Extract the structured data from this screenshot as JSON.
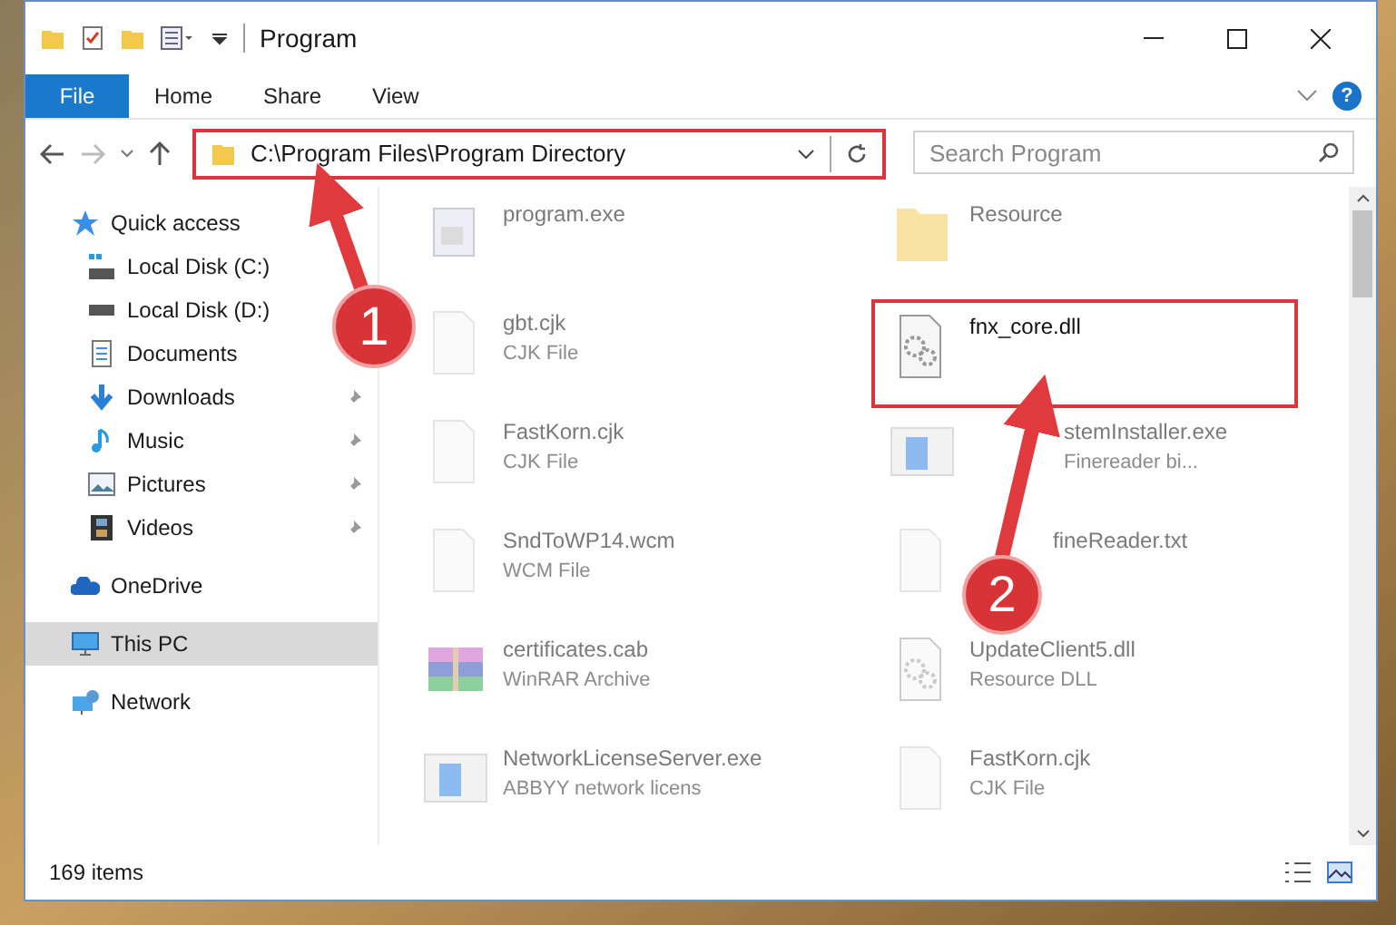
{
  "window": {
    "title": "Program"
  },
  "ribbon": {
    "tabs": [
      {
        "label": "File",
        "kind": "menu"
      },
      {
        "label": "Home",
        "kind": "tab"
      },
      {
        "label": "Share",
        "kind": "tab"
      },
      {
        "label": "View",
        "kind": "tab"
      }
    ],
    "help_button": "?"
  },
  "address_bar": {
    "path": "C:\\Program Files\\Program Directory",
    "highlighted": true
  },
  "search": {
    "placeholder": "Search Program"
  },
  "sidebar": {
    "items": [
      {
        "label": "Quick access",
        "selected": false,
        "children": [
          {
            "label": "Local Disk (C:)",
            "selected": false
          },
          {
            "label": "Local Disk (D:)",
            "selected": false
          },
          {
            "label": "Documents",
            "selected": false
          },
          {
            "label": "Downloads",
            "pinned": true,
            "selected": false
          },
          {
            "label": "Music",
            "pinned": true,
            "selected": false
          },
          {
            "label": "Pictures",
            "pinned": true,
            "selected": false
          },
          {
            "label": "Videos",
            "pinned": true,
            "selected": false
          }
        ]
      },
      {
        "label": "OneDrive",
        "selected": false
      },
      {
        "label": "This PC",
        "selected": true
      },
      {
        "label": "Network",
        "selected": false
      }
    ]
  },
  "files": [
    {
      "name": "program.exe",
      "kind": "application",
      "dimmed": true,
      "highlighted": false
    },
    {
      "name": "Resource",
      "kind": "folder",
      "dimmed": true,
      "highlighted": false
    },
    {
      "name": "gbt.cjk",
      "type": "CJK File",
      "kind": "document",
      "dimmed": true,
      "highlighted": false
    },
    {
      "name": "fnx_core.dll",
      "kind": "library",
      "dimmed": false,
      "highlighted": true
    },
    {
      "name": "FastKorn.cjk",
      "type": "CJK File",
      "kind": "document",
      "dimmed": true,
      "highlighted": false
    },
    {
      "name": "stemInstaller.exe",
      "type": "Finereader bi...",
      "kind": "installer",
      "dimmed": true,
      "highlighted": false,
      "obscured": true
    },
    {
      "name": "SndToWP14.wcm",
      "type": "WCM File",
      "kind": "document",
      "dimmed": true,
      "highlighted": false
    },
    {
      "name": "fineReader.txt",
      "kind": "document",
      "dimmed": true,
      "highlighted": false,
      "obscured": true
    },
    {
      "name": "certificates.cab",
      "type": "WinRAR Archive",
      "kind": "archive",
      "dimmed": true,
      "highlighted": false
    },
    {
      "name": "UpdateClient5.dll",
      "type": "Resource DLL",
      "kind": "library",
      "dimmed": true,
      "highlighted": false
    },
    {
      "name": "NetworkLicenseServer.exe",
      "type": "ABBYY network licens",
      "kind": "installer",
      "dimmed": true,
      "highlighted": false
    },
    {
      "name": "FastKorn.cjk",
      "type": "CJK File",
      "kind": "document",
      "dimmed": true,
      "highlighted": false
    }
  ],
  "status_bar": {
    "count": "169 items"
  },
  "callouts": [
    {
      "number": "1"
    },
    {
      "number": "2"
    }
  ]
}
